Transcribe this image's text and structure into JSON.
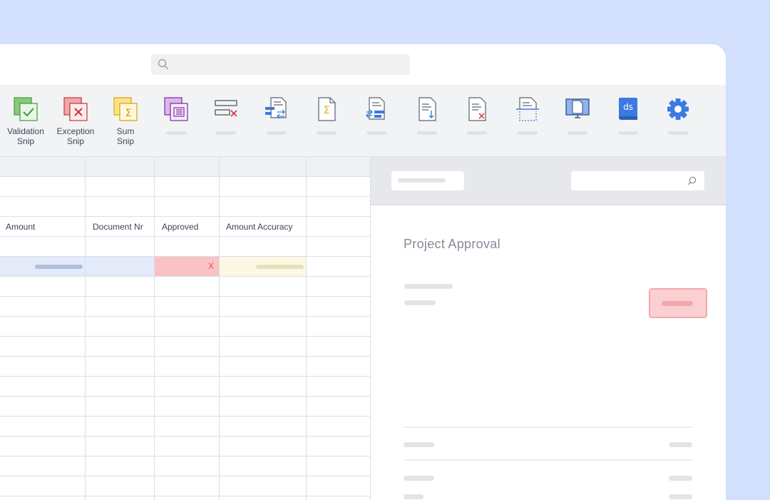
{
  "toolbar": {
    "tools": [
      {
        "label": "Validation\nSnip",
        "icon": "validation-snip-icon"
      },
      {
        "label": "Exception\nSnip",
        "icon": "exception-snip-icon"
      },
      {
        "label": "Sum\nSnip",
        "icon": "sum-snip-icon"
      },
      {
        "label": "",
        "icon": "page-snip-icon"
      },
      {
        "label": "",
        "icon": "remove-field-icon"
      },
      {
        "label": "",
        "icon": "document-fields-icon"
      },
      {
        "label": "",
        "icon": "document-sum-icon"
      },
      {
        "label": "",
        "icon": "document-mapping-icon"
      },
      {
        "label": "",
        "icon": "document-download-icon"
      },
      {
        "label": "",
        "icon": "document-delete-icon"
      },
      {
        "label": "",
        "icon": "document-split-icon"
      },
      {
        "label": "",
        "icon": "monitor-document-icon"
      },
      {
        "label": "",
        "icon": "docsumo-book-icon"
      },
      {
        "label": "",
        "icon": "settings-gear-icon"
      }
    ]
  },
  "sheet": {
    "columns": [
      "Amount",
      "Document Nr",
      "Approved",
      "Amount Accuracy",
      ""
    ],
    "approved_flag": "X"
  },
  "panel": {
    "title": "Project Approval"
  },
  "colors": {
    "background": "#d2e0fd",
    "highlight_row": "#e3ebfb",
    "error_cell": "#f9c3c5",
    "warning_cell": "#fdf8e4",
    "accent_blue": "#3b7ae0"
  }
}
